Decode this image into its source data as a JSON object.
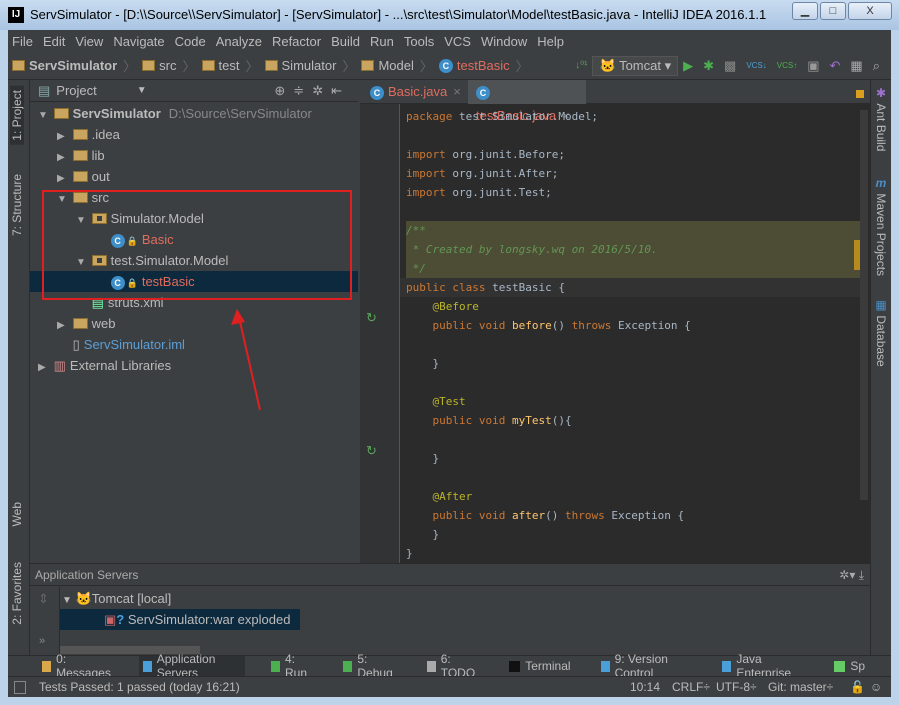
{
  "window": {
    "title": "ServSimulator - [D:\\\\Source\\\\ServSimulator] - [ServSimulator] - ...\\src\\test\\Simulator\\Model\\testBasic.java - IntelliJ IDEA 2016.1.1",
    "minimize": "▁",
    "maximize": "□",
    "close": "X",
    "logo": "IJ"
  },
  "menu": [
    "File",
    "Edit",
    "View",
    "Navigate",
    "Code",
    "Analyze",
    "Refactor",
    "Build",
    "Run",
    "Tools",
    "VCS",
    "Window",
    "Help"
  ],
  "breadcrumb": [
    "ServSimulator",
    "src",
    "test",
    "Simulator",
    "Model",
    "testBasic"
  ],
  "toolbar": {
    "run_config": "Tomcat"
  },
  "leftstrip": {
    "project": "1: Project",
    "structure": "7: Structure",
    "web": "Web",
    "favorites": "2: Favorites"
  },
  "rightstrip": {
    "ant": "Ant Build",
    "maven": "Maven Projects",
    "database": "Database"
  },
  "project": {
    "header": "Project",
    "tree": [
      {
        "label": "ServSimulator",
        "extra": "D:\\Source\\ServSimulator",
        "depth": 0,
        "arrow": "▼",
        "icon": "folder",
        "bold": true
      },
      {
        "label": ".idea",
        "depth": 1,
        "arrow": "▶",
        "icon": "folder"
      },
      {
        "label": "lib",
        "depth": 1,
        "arrow": "▶",
        "icon": "folder"
      },
      {
        "label": "out",
        "depth": 1,
        "arrow": "▶",
        "icon": "folder",
        "color": "#bbbbbb"
      },
      {
        "label": "src",
        "depth": 1,
        "arrow": "▼",
        "icon": "folder"
      },
      {
        "label": "Simulator.Model",
        "depth": 2,
        "arrow": "▼",
        "icon": "package"
      },
      {
        "label": "Basic",
        "depth": 3,
        "arrow": "",
        "icon": "class",
        "color": "#e06c5e"
      },
      {
        "label": "test.Simulator.Model",
        "depth": 2,
        "arrow": "▼",
        "icon": "package"
      },
      {
        "label": "testBasic",
        "depth": 3,
        "arrow": "",
        "icon": "class",
        "color": "#e06c5e",
        "selected": true
      },
      {
        "label": "struts.xml",
        "depth": 2,
        "arrow": "",
        "icon": "xml"
      },
      {
        "label": "web",
        "depth": 1,
        "arrow": "▶",
        "icon": "folder"
      },
      {
        "label": "ServSimulator.iml",
        "depth": 1,
        "arrow": "",
        "icon": "file",
        "color": "#5c9fd6"
      },
      {
        "label": "External Libraries",
        "depth": 0,
        "arrow": "▶",
        "icon": "lib"
      }
    ]
  },
  "editor": {
    "tabs": [
      {
        "label": "Basic.java",
        "close": "×"
      },
      {
        "label": "testBasic.java",
        "close": "×",
        "active": true
      }
    ],
    "lines": [
      [
        [
          "package ",
          "kw"
        ],
        [
          "test.Simulator.Model;",
          ""
        ]
      ],
      [],
      [
        [
          "import ",
          "kw"
        ],
        [
          "org.junit.Before;",
          ""
        ]
      ],
      [
        [
          "import ",
          "kw"
        ],
        [
          "org.junit.After;",
          ""
        ]
      ],
      [
        [
          "import ",
          "kw"
        ],
        [
          "org.junit.Test;",
          ""
        ]
      ],
      [],
      [
        [
          "/**",
          "cm"
        ]
      ],
      [
        [
          " * Created by longsky.wq on 2016/5/10.",
          "cm"
        ]
      ],
      [
        [
          " */",
          "cm"
        ]
      ],
      [
        [
          "public class ",
          "kw"
        ],
        [
          "testBasic {",
          ""
        ]
      ],
      [
        [
          "    ",
          ""
        ],
        [
          "@Before",
          "an"
        ]
      ],
      [
        [
          "    public void ",
          "kw"
        ],
        [
          "before",
          ""
        ],
        [
          "() ",
          ""
        ],
        [
          "throws ",
          "kw"
        ],
        [
          "Exception {",
          ""
        ]
      ],
      [],
      [
        [
          "    }",
          ""
        ]
      ],
      [],
      [
        [
          "    ",
          ""
        ],
        [
          "@Test",
          "an"
        ]
      ],
      [
        [
          "    public void ",
          "kw"
        ],
        [
          "myTest",
          ""
        ],
        [
          "(){",
          ""
        ]
      ],
      [],
      [
        [
          "    }",
          ""
        ]
      ],
      [],
      [
        [
          "    ",
          ""
        ],
        [
          "@After",
          "an"
        ]
      ],
      [
        [
          "    public void ",
          "kw"
        ],
        [
          "after",
          ""
        ],
        [
          "() ",
          ""
        ],
        [
          "throws ",
          "kw"
        ],
        [
          "Exception {",
          ""
        ]
      ],
      [
        [
          "    }",
          ""
        ]
      ],
      [
        [
          "}",
          ""
        ]
      ]
    ]
  },
  "bottom": {
    "header": "Application Servers",
    "server": "Tomcat [local]",
    "artifact": "ServSimulator:war exploded",
    "more": "»"
  },
  "toolwindows": [
    {
      "label": "0: Messages",
      "icon": "messages-icon"
    },
    {
      "label": "Application Servers",
      "icon": "app-servers-icon",
      "active": true
    },
    {
      "label": "4: Run",
      "icon": "run-icon"
    },
    {
      "label": "5: Debug",
      "icon": "debug-icon"
    },
    {
      "label": "6: TODO",
      "icon": "todo-icon"
    },
    {
      "label": "Terminal",
      "icon": "terminal-icon"
    },
    {
      "label": "9: Version Control",
      "icon": "vcs-icon"
    },
    {
      "label": "Java Enterprise",
      "icon": "java-ee-icon"
    },
    {
      "label": "Sp",
      "icon": "spring-icon"
    }
  ],
  "status": {
    "message": "Tests Passed: 1 passed (today 16:21)",
    "position": "10:14",
    "line_sep": "CRLF÷",
    "encoding": "UTF-8÷",
    "vcs": "Git: master÷"
  },
  "colors": {
    "annotation_box": "#e02020",
    "accent": "#e06c5e"
  }
}
